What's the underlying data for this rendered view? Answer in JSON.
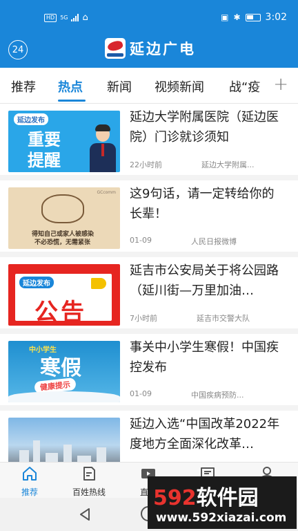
{
  "status_bar": {
    "network_badge": "HD",
    "network_gen": "5G",
    "time": "3:02"
  },
  "header": {
    "timer_badge": "24",
    "title": "延边广电",
    "accent_color": "#1a86d9"
  },
  "tabs": [
    {
      "label": "推荐",
      "active": false
    },
    {
      "label": "热点",
      "active": true
    },
    {
      "label": "新闻",
      "active": false
    },
    {
      "label": "视频新闻",
      "active": false
    },
    {
      "label": "战“疫",
      "active": false
    }
  ],
  "feed": [
    {
      "title": "延边大学附属医院（延边医院）门诊就诊须知",
      "time": "22小时前",
      "source": "延边大学附属...",
      "thumb": {
        "tag": "延边发布",
        "line1": "重要",
        "line2": "提醒"
      }
    },
    {
      "title": "这9句话，请一定转给你的长辈！",
      "time": "01-09",
      "source": "人民日报微博",
      "thumb": {
        "line1": "得知自己或家人被感染",
        "line2": "不必恐慌，无需紧张",
        "mark": "GCcomm"
      }
    },
    {
      "title": "延吉市公安局关于将公园路（延川街—万里加油…",
      "time": "7小时前",
      "source": "延吉市交警大队",
      "thumb": {
        "tag": "延边发布",
        "line1": "公告"
      }
    },
    {
      "title": "事关中小学生寒假！中国疾控发布",
      "time": "01-09",
      "source": "中国疾病预防...",
      "thumb": {
        "line0": "中小学生",
        "line1": "寒假",
        "line2": "健康提示"
      }
    },
    {
      "title": "延边入选“中国改革2022年度地方全面深化改革…",
      "time": "",
      "source": ""
    }
  ],
  "bottom_nav": [
    {
      "label": "推荐",
      "icon": "home-icon",
      "active": true
    },
    {
      "label": "百姓热线",
      "icon": "document-icon",
      "active": false
    },
    {
      "label": "直播",
      "icon": "tv-icon",
      "active": false
    },
    {
      "label": "",
      "icon": "message-icon",
      "active": false
    },
    {
      "label": "",
      "icon": "user-icon",
      "active": false
    }
  ],
  "watermark": {
    "num": "592",
    "text": "软件园",
    "url": "www.592xiazai.com"
  }
}
